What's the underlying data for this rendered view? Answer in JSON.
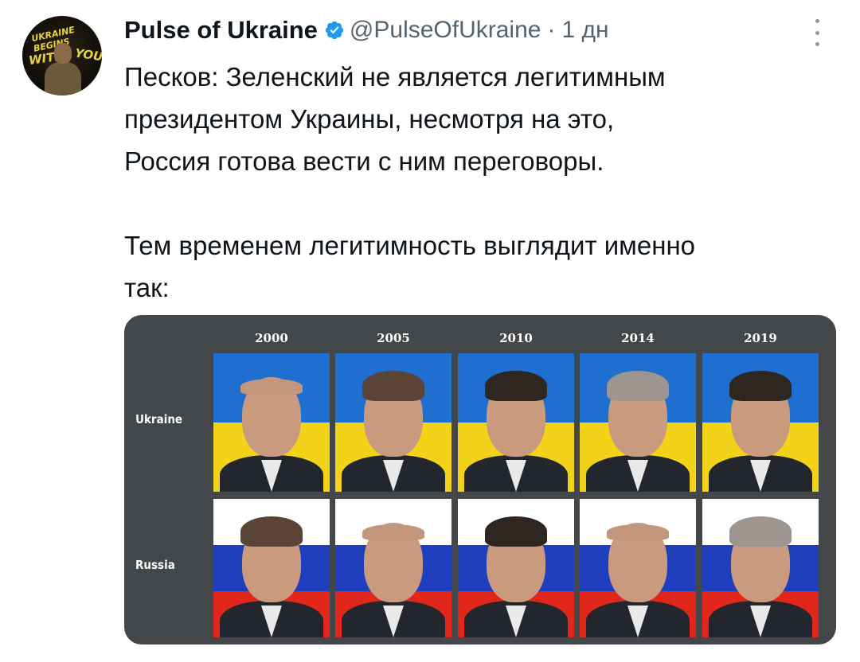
{
  "tweet": {
    "display_name": "Pulse of Ukraine",
    "handle": "@PulseOfUkraine",
    "separator": "·",
    "time": "1 дн",
    "text_lines": [
      "Песков: Зеленский не является легитимным",
      "президентом Украины, несмотря на это,",
      "Россия готова вести с ним переговоры."
    ],
    "text_lines_2": [
      "Тем временем легитимность выглядит именно",
      "так:"
    ]
  },
  "avatar": {
    "lettering_top": "UKRAINE BEGINS",
    "lettering_left": "WITH",
    "lettering_right": "YOU"
  },
  "media": {
    "years": [
      "2000",
      "2005",
      "2010",
      "2014",
      "2019"
    ],
    "rows": [
      "Ukraine",
      "Russia"
    ]
  },
  "colors": {
    "verified_badge": "#1d9bf0",
    "ukraine_blue": "#1e6fd0",
    "ukraine_yellow": "#f3d21a",
    "russia_red": "#e1261c",
    "russia_blue": "#1f3fbf",
    "media_background": "#444749"
  },
  "icons": {
    "verified": "verified-badge-icon",
    "more": "more-options-icon"
  }
}
